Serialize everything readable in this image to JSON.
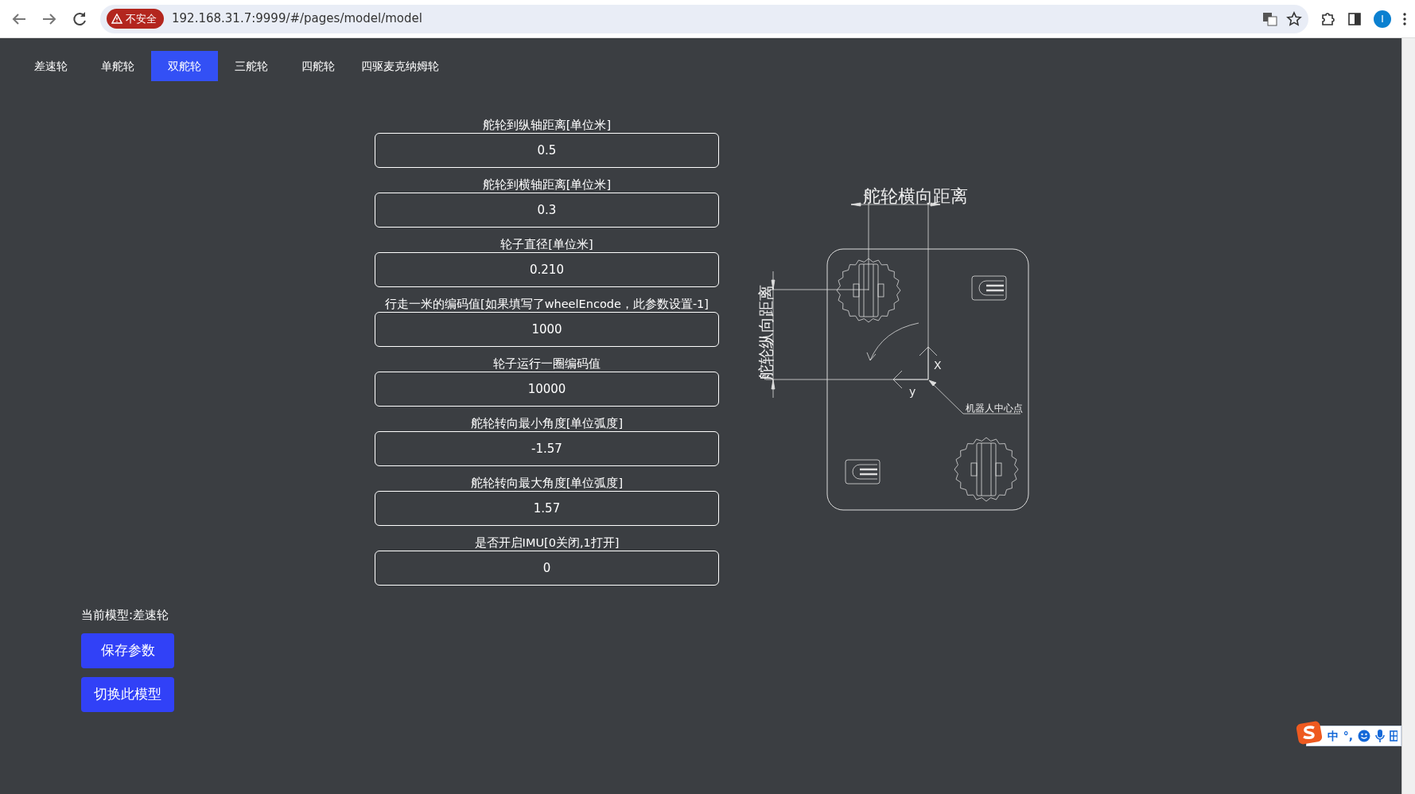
{
  "browser": {
    "security_label": "不安全",
    "url": "192.168.31.7:9999/#/pages/model/model",
    "profile_initial": "I"
  },
  "tabs": [
    {
      "label": "差速轮",
      "selected": false
    },
    {
      "label": "单舵轮",
      "selected": false
    },
    {
      "label": "双舵轮",
      "selected": true
    },
    {
      "label": "三舵轮",
      "selected": false
    },
    {
      "label": "四舵轮",
      "selected": false
    },
    {
      "label": "四驱麦克纳姆轮",
      "selected": false
    }
  ],
  "fields": [
    {
      "label": "舵轮到纵轴距离[单位米]",
      "value": "0.5"
    },
    {
      "label": "舵轮到横轴距离[单位米]",
      "value": "0.3"
    },
    {
      "label": "轮子直径[单位米]",
      "value": "0.210"
    },
    {
      "label": "行走一米的编码值[如果填写了wheelEncode，此参数设置-1]",
      "value": "1000"
    },
    {
      "label": "轮子运行一圈编码值",
      "value": "10000"
    },
    {
      "label": "舵轮转向最小角度[单位弧度]",
      "value": "-1.57"
    },
    {
      "label": "舵轮转向最大角度[单位弧度]",
      "value": "1.57"
    },
    {
      "label": "是否开启IMU[0关闭,1打开]",
      "value": "0"
    }
  ],
  "diagram": {
    "title": "舵轮横向距离",
    "side_label": "舵轮纵向距离",
    "x_axis": "X",
    "y_axis": "y",
    "center_label": "机器人中心点"
  },
  "current_model": "当前模型:差速轮",
  "buttons": [
    "保存参数",
    "切换此模型"
  ],
  "ime": {
    "mode": "中",
    "punct": "°,"
  }
}
